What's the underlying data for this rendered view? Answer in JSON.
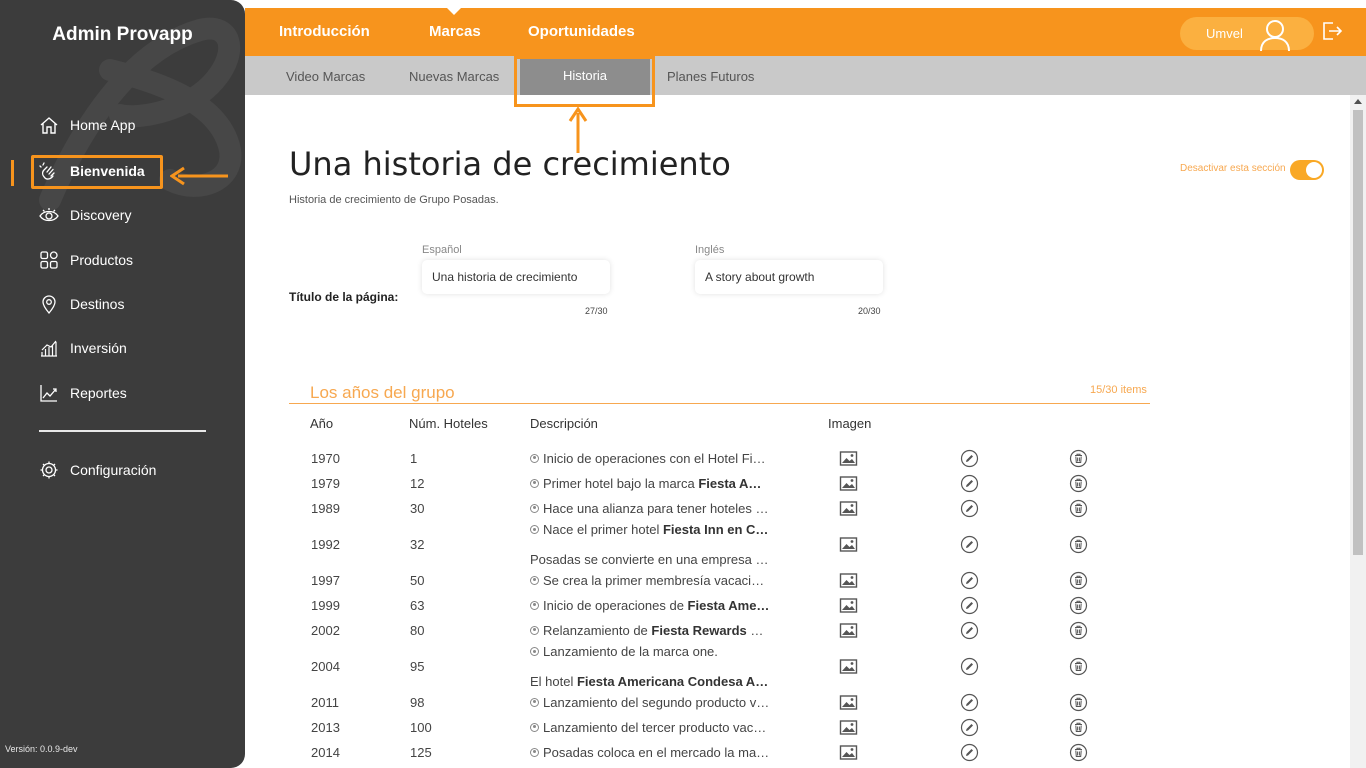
{
  "sidebar": {
    "brand": "Admin Provapp",
    "items": [
      {
        "label": "Home App",
        "icon": "home-icon"
      },
      {
        "label": "Bienvenida",
        "icon": "waving-hand-icon"
      },
      {
        "label": "Discovery",
        "icon": "eye-icon"
      },
      {
        "label": "Productos",
        "icon": "grid-icon"
      },
      {
        "label": "Destinos",
        "icon": "location-pin-icon"
      },
      {
        "label": "Inversión",
        "icon": "bar-chart-icon"
      },
      {
        "label": "Reportes",
        "icon": "line-chart-icon"
      }
    ],
    "config_label": "Configuración",
    "version": "Versión: 0.0.9-dev"
  },
  "topbar": {
    "tabs": [
      "Introducción",
      "Marcas",
      "Oportunidades"
    ],
    "active_tab": "Marcas",
    "user_name": "Umvel"
  },
  "subtabs": {
    "items": [
      "Video Marcas",
      "Nuevas Marcas",
      "Historia",
      "Planes Futuros"
    ],
    "active": "Historia"
  },
  "page": {
    "title": "Una historia de crecimiento",
    "subtitle": "Historia de crecimiento de Grupo Posadas.",
    "toggle_label": "Desactivar esta sección",
    "toggle_on": true
  },
  "form": {
    "row_label": "Título de la página:",
    "es": {
      "label": "Español",
      "value": "Una historia de crecimiento",
      "count": "27/30"
    },
    "en": {
      "label": "Inglés",
      "value": "A story about growth",
      "count": "20/30"
    }
  },
  "section": {
    "title": "Los años del grupo",
    "count": "15/30 items",
    "headers": [
      "Año",
      "Núm. Hoteles",
      "Descripción",
      "Imagen"
    ]
  },
  "rows": [
    {
      "year": "1970",
      "hotels": "1",
      "lines": [
        {
          "dot": true,
          "pre": "Inicio de operaciones con el Hotel Fi…",
          "bold": "",
          "post": ""
        }
      ]
    },
    {
      "year": "1979",
      "hotels": "12",
      "lines": [
        {
          "dot": true,
          "pre": "Primer hotel bajo la marca ",
          "bold": "Fiesta A…",
          "post": ""
        }
      ]
    },
    {
      "year": "1989",
      "hotels": "30",
      "lines": [
        {
          "dot": true,
          "pre": "Hace una alianza para tener hoteles …",
          "bold": "",
          "post": ""
        }
      ]
    },
    {
      "year": "1992",
      "hotels": "32",
      "lines": [
        {
          "dot": true,
          "pre": "Nace el primer hotel ",
          "bold": "Fiesta Inn en C…",
          "post": ""
        },
        {
          "dot": false,
          "pre": "Posadas se convierte en una empresa …",
          "bold": "",
          "post": ""
        }
      ]
    },
    {
      "year": "1997",
      "hotels": "50",
      "lines": [
        {
          "dot": true,
          "pre": "Se crea la primer membresía vacacio…",
          "bold": "",
          "post": ""
        }
      ]
    },
    {
      "year": "1999",
      "hotels": "63",
      "lines": [
        {
          "dot": true,
          "pre": "Inicio de operaciones de ",
          "bold": "Fiesta Ame…",
          "post": ""
        }
      ]
    },
    {
      "year": "2002",
      "hotels": "80",
      "lines": [
        {
          "dot": true,
          "pre": "Relanzamiento de ",
          "bold": "Fiesta Rewards",
          "post": " e…"
        }
      ]
    },
    {
      "year": "2004",
      "hotels": "95",
      "lines": [
        {
          "dot": true,
          "pre": "Lanzamiento de la marca one.",
          "bold": "",
          "post": ""
        },
        {
          "dot": false,
          "pre": "El hotel ",
          "bold": "Fiesta Americana Condesa A…",
          "post": ""
        }
      ]
    },
    {
      "year": "2011",
      "hotels": "98",
      "lines": [
        {
          "dot": true,
          "pre": "Lanzamiento del segundo producto v…",
          "bold": "",
          "post": ""
        }
      ]
    },
    {
      "year": "2013",
      "hotels": "100",
      "lines": [
        {
          "dot": true,
          "pre": "Lanzamiento del tercer producto vac…",
          "bold": "",
          "post": ""
        }
      ]
    },
    {
      "year": "2014",
      "hotels": "125",
      "lines": [
        {
          "dot": true,
          "pre": "Posadas coloca en el mercado la ma…",
          "bold": "",
          "post": ""
        }
      ]
    }
  ],
  "colors": {
    "accent": "#f7941d",
    "sidebar": "#3c3c3c",
    "subtabs": "#c9c9c9",
    "active_subtab": "#8d8d8d"
  }
}
